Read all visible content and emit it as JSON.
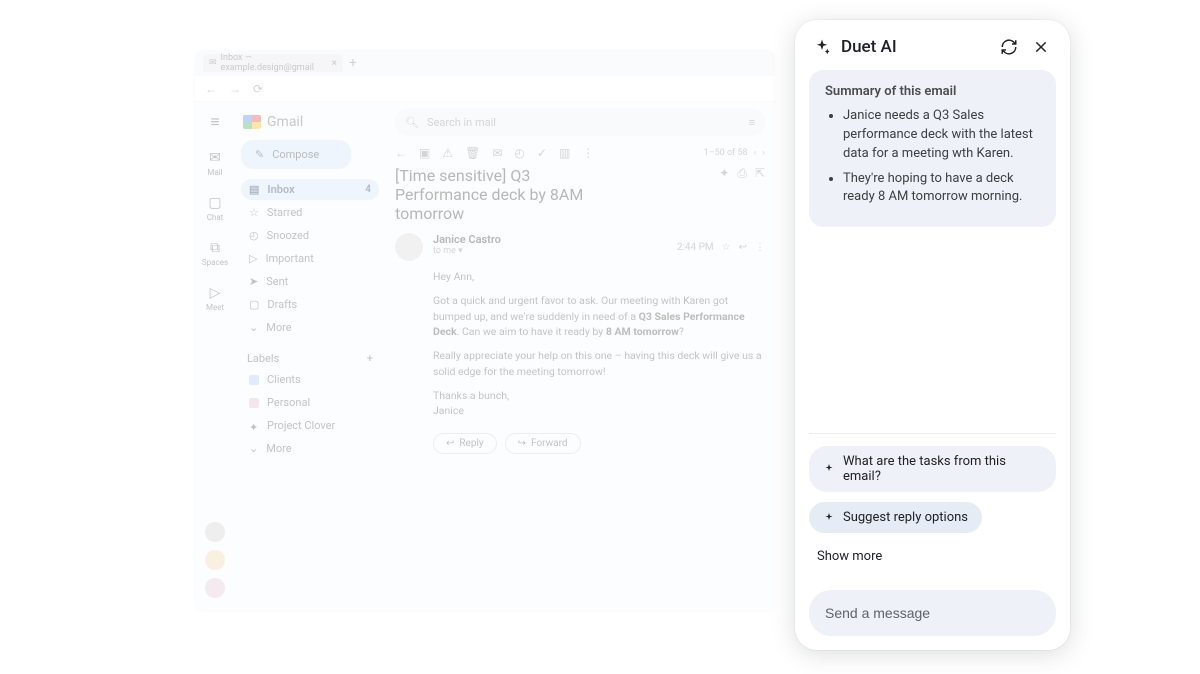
{
  "browser": {
    "tab_title": "Inbox — example.design@gmail"
  },
  "leftrail": {
    "mail": "Mail",
    "chat": "Chat",
    "spaces": "Spaces",
    "meet": "Meet"
  },
  "gmail": {
    "product": "Gmail",
    "search_placeholder": "Search in mail",
    "compose": "Compose",
    "nav": {
      "inbox": "Inbox",
      "inbox_count": "4",
      "starred": "Starred",
      "snoozed": "Snoozed",
      "important": "Important",
      "sent": "Sent",
      "drafts": "Drafts",
      "more": "More"
    },
    "labels_header": "Labels",
    "labels": {
      "clients": "Clients",
      "personal": "Personal",
      "project": "Project Clover",
      "more": "More"
    },
    "pager": "1–50 of 58",
    "subject": "[Time sensitive] Q3 Performance deck by 8AM tomorrow",
    "from": "Janice Castro",
    "to": "to me",
    "time": "2:44 PM",
    "body": {
      "greet": "Hey Ann,",
      "p1a": "Got a quick and urgent favor to ask. Our meeting with Karen got bumped up, and we're suddenly in need of a ",
      "p1bold1": "Q3 Sales Performance Deck",
      "p1b": ". Can we aim to have it ready by ",
      "p1bold2": "8 AM tomorrow",
      "p1c": "?",
      "p2": "Really appreciate your help on this one – having this deck will give us a solid edge for the meeting tomorrow!",
      "sign1": "Thanks a bunch,",
      "sign2": "Janice"
    },
    "reply": "Reply",
    "forward": "Forward"
  },
  "duet": {
    "title": "Duet AI",
    "summary_header": "Summary of this email",
    "bullets": [
      "Janice needs a Q3 Sales performance deck with the latest data for a meeting wth Karen.",
      "They're hoping to have a deck ready 8 AM tomorrow morning."
    ],
    "chips": [
      "What are the tasks from this email?",
      "Suggest reply options"
    ],
    "show_more": "Show more",
    "input_placeholder": "Send a message"
  }
}
